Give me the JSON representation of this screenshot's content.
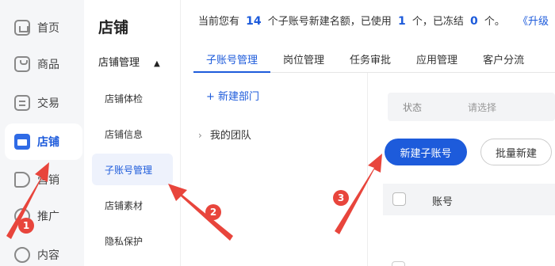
{
  "rail": {
    "items": [
      {
        "label": "首页",
        "icon": "home-icon"
      },
      {
        "label": "商品",
        "icon": "bag-icon"
      },
      {
        "label": "交易",
        "icon": "trade-icon"
      },
      {
        "label": "店铺",
        "icon": "store-icon"
      },
      {
        "label": "营销",
        "icon": "megaphone-icon"
      },
      {
        "label": "推广",
        "icon": "promo-icon"
      },
      {
        "label": "内容",
        "icon": "content-icon"
      }
    ],
    "active": "店铺"
  },
  "submenu": {
    "title": "店铺",
    "group": "店铺管理",
    "items": [
      {
        "label": "店铺体检"
      },
      {
        "label": "店铺信息"
      },
      {
        "label": "子账号管理"
      },
      {
        "label": "店铺素材"
      },
      {
        "label": "隐私保护"
      }
    ],
    "active": "子账号管理"
  },
  "quota": {
    "prefix": "当前您有",
    "total": "14",
    "mid1": "个子账号新建名额，已使用",
    "used": "1",
    "mid2": "个，已冻结",
    "frozen": "0",
    "suffix": "个。",
    "upgrade_link": "《升级"
  },
  "tabs": [
    "子账号管理",
    "岗位管理",
    "任务审批",
    "应用管理",
    "客户分流"
  ],
  "tree": {
    "new_dept": "+ 新建部门",
    "team_chevron": "›",
    "team_label": "我的团队"
  },
  "filter": {
    "label": "状态",
    "placeholder": "请选择"
  },
  "actions": {
    "create": "新建子账号",
    "batch": "批量新建"
  },
  "table": {
    "columns": [
      "账号"
    ]
  },
  "annotations": {
    "badges": [
      "1",
      "2",
      "3"
    ],
    "color": "#e8453c"
  },
  "colors": {
    "accent": "#1d5bdb",
    "sidebar_bg": "#f5f6f8"
  }
}
